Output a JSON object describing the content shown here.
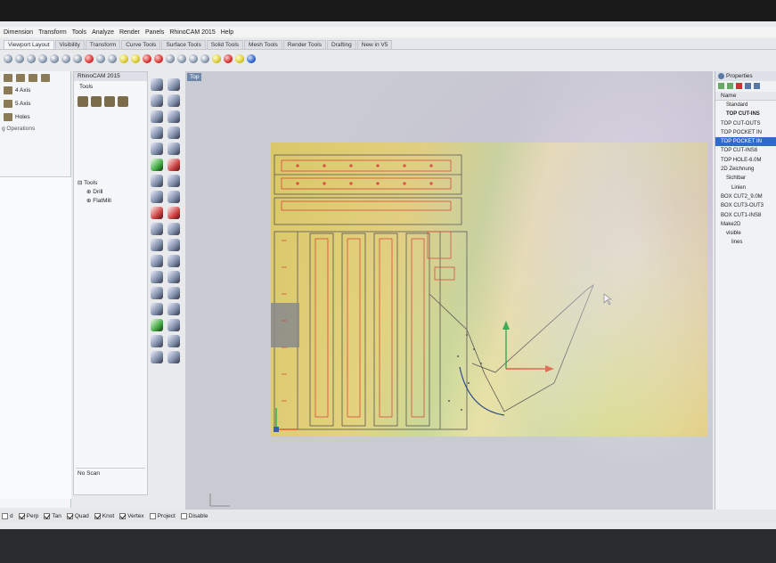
{
  "menu": [
    "Dimension",
    "Transform",
    "Tools",
    "Analyze",
    "Render",
    "Panels",
    "RhinoCAM 2015",
    "Help"
  ],
  "tabs": [
    {
      "label": "Viewport Layout",
      "active": true
    },
    {
      "label": "Visibility"
    },
    {
      "label": "Transform"
    },
    {
      "label": "Curve Tools"
    },
    {
      "label": "Surface Tools"
    },
    {
      "label": "Solid Tools"
    },
    {
      "label": "Mesh Tools"
    },
    {
      "label": "Render Tools"
    },
    {
      "label": "Drafting"
    },
    {
      "label": "New in V5"
    }
  ],
  "left_panel": {
    "rows": [
      {
        "icon": "axis-icon",
        "label": "4 Axis"
      },
      {
        "icon": "axis-icon",
        "label": "5 Axis"
      },
      {
        "icon": "hole-icon",
        "label": "Holes"
      }
    ],
    "ops_label": "g Operations"
  },
  "browser": {
    "title": "RhinoCAM 2015",
    "tab_label": "Tools",
    "tree": [
      {
        "label": "Tools",
        "level": 0
      },
      {
        "label": "Drill",
        "level": 1
      },
      {
        "label": "FlatMill",
        "level": 1
      }
    ],
    "footer": "No Scan"
  },
  "viewport": {
    "label": "Top"
  },
  "properties": {
    "title": "Properties",
    "column_header": "Name",
    "layers": [
      {
        "name": "Standard",
        "style": "normal",
        "indent": 1
      },
      {
        "name": "TOP CUT-INS",
        "style": "bold",
        "indent": 1
      },
      {
        "name": "TOP CUT-OUTS",
        "style": "normal",
        "indent": 0
      },
      {
        "name": "TOP POCKET IN",
        "style": "normal",
        "indent": 0
      },
      {
        "name": "TOP POCKET IN",
        "style": "selected",
        "indent": 0
      },
      {
        "name": "TOP CUT-INS8",
        "style": "normal",
        "indent": 0
      },
      {
        "name": "TOP HOLE-6.0M",
        "style": "normal",
        "indent": 0
      },
      {
        "name": "2D Zeichnung",
        "style": "normal",
        "indent": 0
      },
      {
        "name": "Sichtbar",
        "style": "normal",
        "indent": 1
      },
      {
        "name": "Linien",
        "style": "normal",
        "indent": 2
      },
      {
        "name": "BOX CUT2_9.0M",
        "style": "normal",
        "indent": 0
      },
      {
        "name": "BOX CUT3-OUT3",
        "style": "normal",
        "indent": 0
      },
      {
        "name": "BOX CUT1-INS8",
        "style": "normal",
        "indent": 0
      },
      {
        "name": "Make2D",
        "style": "normal",
        "indent": 0
      },
      {
        "name": "visible",
        "style": "normal",
        "indent": 1
      },
      {
        "name": "lines",
        "style": "normal",
        "indent": 2
      }
    ]
  },
  "status": {
    "snaps": [
      {
        "label": "d",
        "checked": false
      },
      {
        "label": "Perp",
        "checked": true
      },
      {
        "label": "Tan",
        "checked": true
      },
      {
        "label": "Quad",
        "checked": true
      },
      {
        "label": "Knot",
        "checked": true
      },
      {
        "label": "Vertex",
        "checked": true
      },
      {
        "label": "Project",
        "checked": false
      },
      {
        "label": "Disable",
        "checked": false
      }
    ]
  },
  "colors": {
    "selection": "#2f6ad0",
    "sheet": "#e0cf7e",
    "cut_lines": "#d94a3a",
    "outline": "#444444"
  }
}
